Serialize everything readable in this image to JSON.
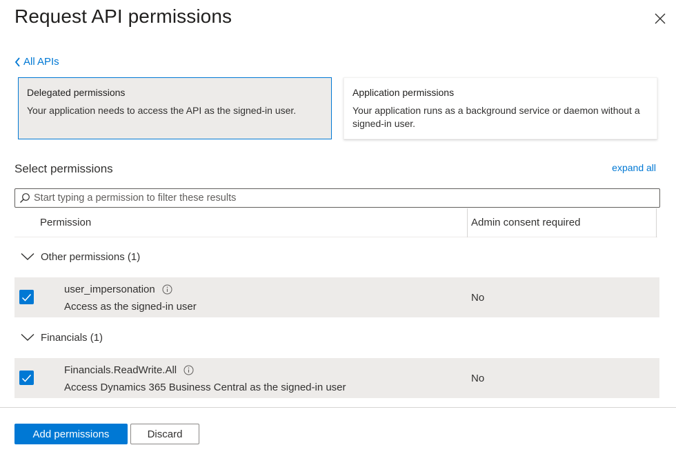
{
  "panel": {
    "title": "Request API permissions",
    "close_icon": "close-icon"
  },
  "back_link": {
    "label": "All APIs",
    "icon": "chevron-left-icon"
  },
  "permission_types": {
    "delegated": {
      "title": "Delegated permissions",
      "description": "Your application needs to access the API as the signed-in user.",
      "selected": true
    },
    "application": {
      "title": "Application permissions",
      "description": "Your application runs as a background service or daemon without a signed-in user.",
      "selected": false
    }
  },
  "select": {
    "heading": "Select permissions",
    "expand_all": "expand all",
    "search_placeholder": "Start typing a permission to filter these results",
    "search_value": ""
  },
  "columns": {
    "permission": "Permission",
    "admin_consent": "Admin consent required"
  },
  "groups": [
    {
      "label": "Other permissions (1)",
      "expanded": true,
      "items": [
        {
          "name": "user_impersonation",
          "description": "Access as the signed-in user",
          "admin_consent": "No",
          "checked": true
        }
      ]
    },
    {
      "label": "Financials (1)",
      "expanded": true,
      "items": [
        {
          "name": "Financials.ReadWrite.All",
          "description": "Access Dynamics 365 Business Central as the signed-in user",
          "admin_consent": "No",
          "checked": true
        }
      ]
    }
  ],
  "footer": {
    "add_label": "Add permissions",
    "discard_label": "Discard"
  },
  "colors": {
    "accent": "#0078d4",
    "selected_bg": "#edebe9",
    "text": "#323130"
  }
}
